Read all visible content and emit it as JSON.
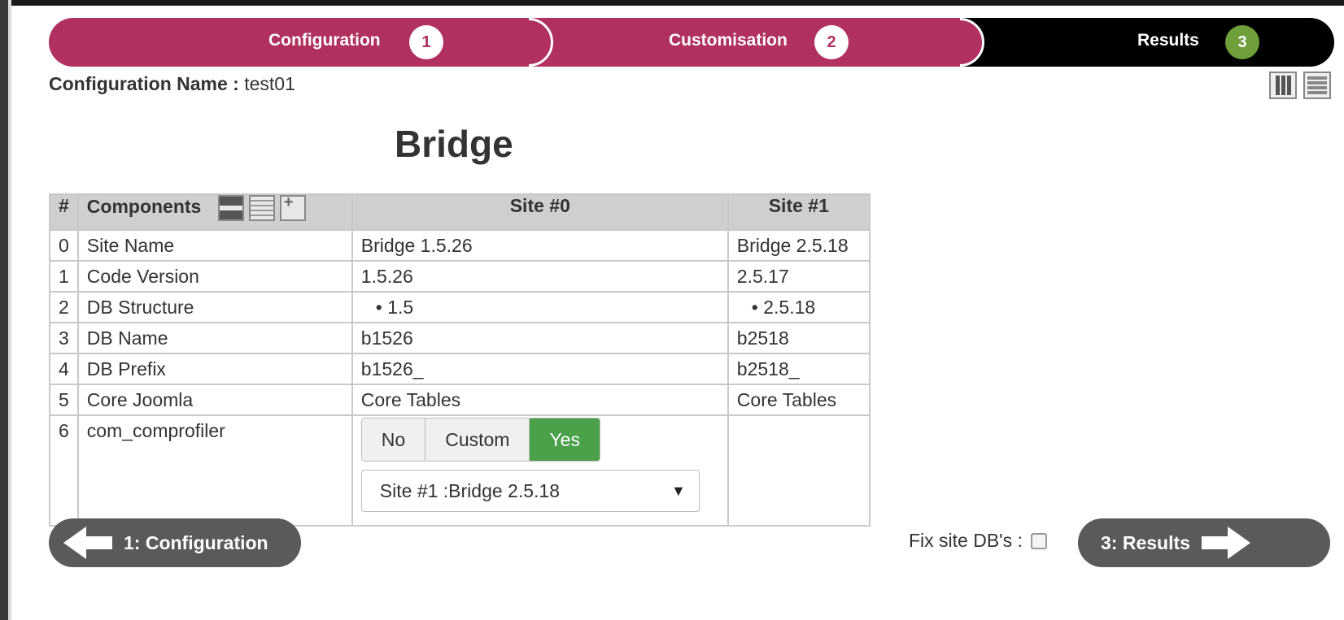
{
  "steps": [
    {
      "label": "Configuration",
      "number": "1"
    },
    {
      "label": "Customisation",
      "number": "2"
    },
    {
      "label": "Results",
      "number": "3"
    }
  ],
  "config": {
    "name_label": "Configuration Name :",
    "name_value": "test01"
  },
  "page_title": "Bridge",
  "table": {
    "headers": [
      "#",
      "Components",
      "Site #0",
      "Site #1"
    ],
    "rows": [
      {
        "num": "0",
        "component": "Site Name",
        "site0": "Bridge 1.5.26",
        "site1": "Bridge 2.5.18"
      },
      {
        "num": "1",
        "component": "Code Version",
        "site0": "1.5.26",
        "site1": "2.5.17"
      },
      {
        "num": "2",
        "component": "DB Structure",
        "site0": "1.5",
        "site1": "2.5.18"
      },
      {
        "num": "3",
        "component": "DB Name",
        "site0": "b1526",
        "site1": "b2518"
      },
      {
        "num": "4",
        "component": "DB Prefix",
        "site0": "b1526_",
        "site1": "b2518_"
      },
      {
        "num": "5",
        "component": "Core Joomla",
        "site0": "Core Tables",
        "site1": "Core Tables"
      },
      {
        "num": "6",
        "component": "com_comprofiler",
        "site0": "",
        "site1": ""
      }
    ],
    "row6": {
      "buttons": {
        "no": "No",
        "custom": "Custom",
        "yes": "Yes",
        "selected": "Yes"
      },
      "select_value": "Site #1 :Bridge 2.5.18"
    }
  },
  "nav": {
    "prev_label": "1: Configuration",
    "next_label": "3: Results"
  },
  "fix_db": {
    "label": "Fix site DB's :",
    "checked": false
  },
  "colors": {
    "accent": "#b0305f",
    "success": "#4aa14a",
    "step3": "#6f9e3a",
    "nav": "#5a5a5a"
  }
}
